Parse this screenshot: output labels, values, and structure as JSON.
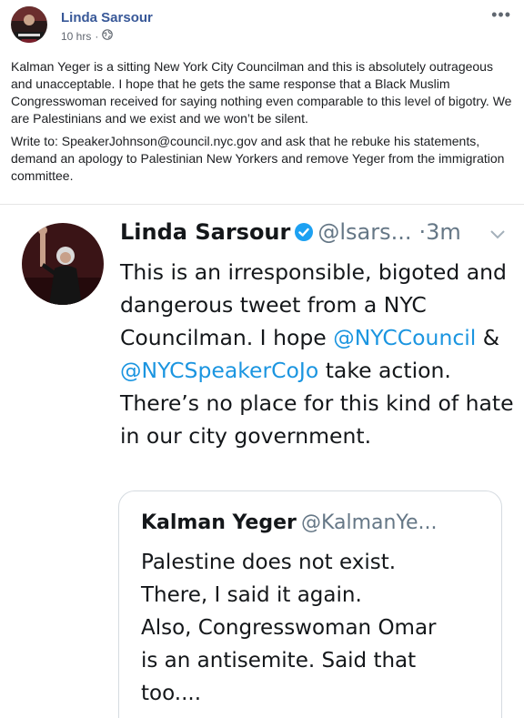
{
  "post": {
    "author": "Linda Sarsour",
    "time": "10 hrs",
    "more_label": "•••",
    "paragraph1": "Kalman Yeger is a sitting New York City Councilman and this is absolutely outrageous and unacceptable. I hope that he gets the same response that a Black Muslim Congresswoman received for saying nothing even comparable to this level of bigotry. We are Palestinians and we exist and we won’t be silent.",
    "paragraph2": "Write to: SpeakerJohnson@council.nyc.gov and ask that he rebuke his statements, demand an apology to Palestinian New Yorkers and remove Yeger from the immigration committee.",
    "audience_icon": "globe-icon"
  },
  "tweet": {
    "name": "Linda Sarsour",
    "handle": "@lsars...",
    "dot": "·",
    "time": "3m",
    "body_before": "This is an irresponsible, bigoted and dangerous tweet from a NYC Councilman. I hope ",
    "mention1": "@NYCCouncil",
    "body_mid": " & ",
    "mention2": "@NYCSpeakerCoJo",
    "body_after": " take action. There’s no place for this kind of hate in our city government.",
    "verified_color": "#1da1f2",
    "mention_color": "#1b95e0"
  },
  "quote": {
    "name": "Kalman Yeger",
    "handle": "@KalmanYe...",
    "body": "Palestine does not exist.\nThere, I said it again.\nAlso, Congresswoman Omar\nis an antisemite.  Said that\ntoo...."
  },
  "colors": {
    "author_link": "#385898",
    "meta_gray": "#616770"
  }
}
